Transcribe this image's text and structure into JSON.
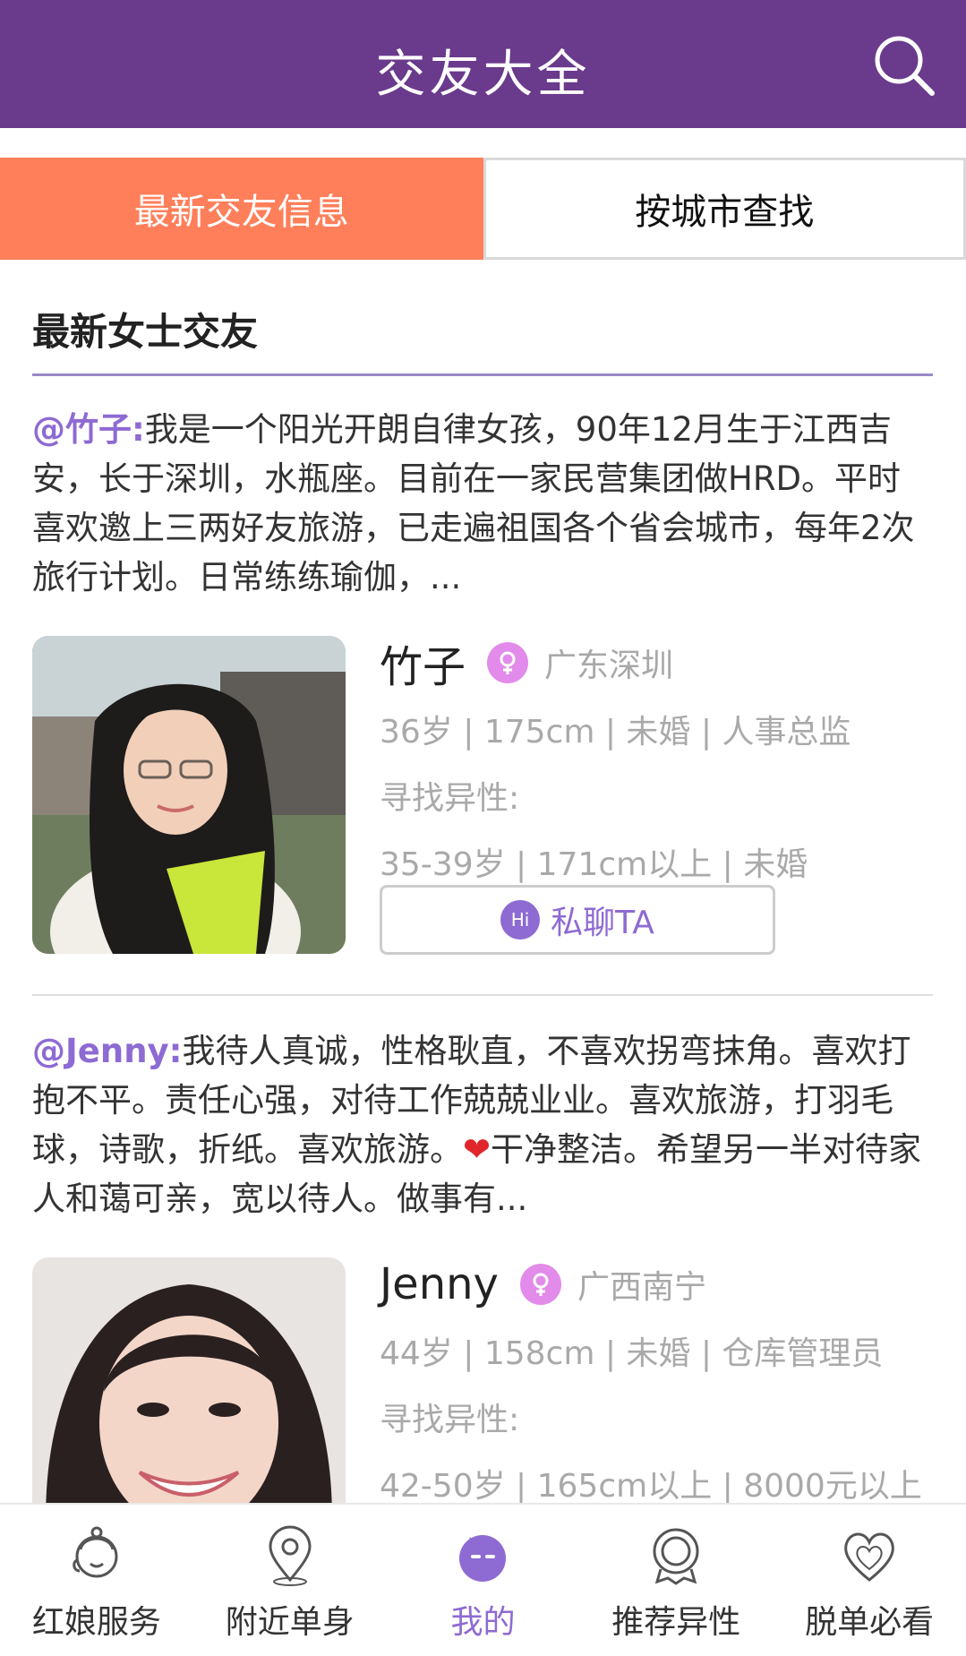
{
  "header": {
    "title": "交友大全",
    "search_icon": "search-icon"
  },
  "tabs": [
    {
      "label": "最新交友信息",
      "active": true
    },
    {
      "label": "按城市查找",
      "active": false
    }
  ],
  "section": {
    "title": "最新女士交友"
  },
  "posts": [
    {
      "author": "@竹子:",
      "intro": "我是一个阳光开朗自律女孩，90年12月生于江西吉安，长于深圳，水瓶座。目前在一家民营集团做HRD。平时喜欢邀上三两好友旅游，已走遍祖国各个省会城市，每年2次旅行计划。日常练练瑜伽，...",
      "name": "竹子",
      "city": "广东深圳",
      "stats": "36岁 | 175cm | 未婚 | 人事总监",
      "seek_label": "寻找异性:",
      "seek": "35-39岁 | 171cm以上 | 未婚",
      "chat_label": "私聊TA",
      "chat_badge": "Hi"
    },
    {
      "author": "@Jenny:",
      "intro_before": "我待人真诚，性格耿直，不喜欢拐弯抹角。喜欢打抱不平。责任心强，对待工作兢兢业业。喜欢旅游，打羽毛球，诗歌，折纸。喜欢旅游。",
      "heart": "❤",
      "intro_after": "干净整洁。希望另一半对待家人和蔼可亲，宽以待人。做事有...",
      "name": "Jenny",
      "city": "广西南宁",
      "stats": "44岁 | 158cm | 未婚 | 仓库管理员",
      "seek_label": "寻找异性:",
      "seek": "42-50岁 | 165cm以上 | 8000元以上"
    }
  ],
  "nav": [
    {
      "label": "红娘服务",
      "icon": "matchmaker-icon",
      "active": false
    },
    {
      "label": "附近单身",
      "icon": "location-pin-icon",
      "active": false
    },
    {
      "label": "我的",
      "icon": "profile-face-icon",
      "active": true
    },
    {
      "label": "推荐异性",
      "icon": "recommend-icon",
      "active": false
    },
    {
      "label": "脱单必看",
      "icon": "heart-icon",
      "active": false
    }
  ],
  "colors": {
    "header": "#6a3a8c",
    "accent": "#8e6ad3",
    "tab_active": "#ff7f5a"
  }
}
